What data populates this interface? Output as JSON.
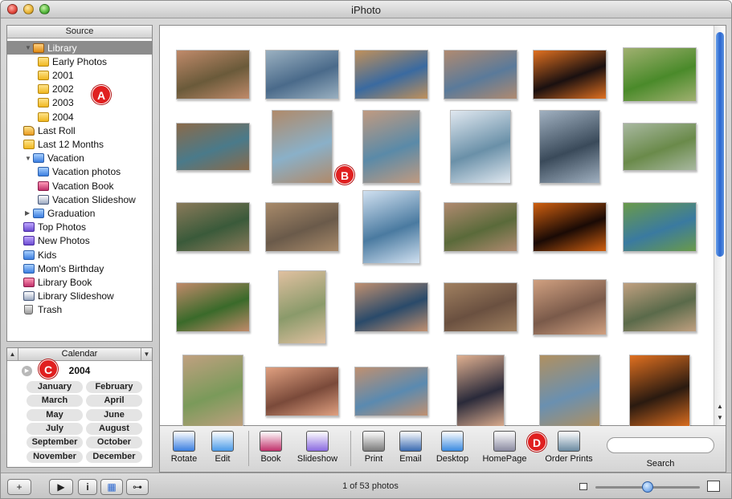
{
  "window": {
    "title": "iPhoto"
  },
  "source": {
    "header": "Source",
    "items": [
      {
        "label": "Library",
        "icon": "library-icon",
        "type": "libfolder",
        "indent": 0,
        "expand": "open",
        "selected": true
      },
      {
        "label": "Early Photos",
        "icon": "folder-icon",
        "type": "folder",
        "indent": 1
      },
      {
        "label": "2001",
        "icon": "folder-icon",
        "type": "folder",
        "indent": 1
      },
      {
        "label": "2002",
        "icon": "folder-icon",
        "type": "folder",
        "indent": 1
      },
      {
        "label": "2003",
        "icon": "folder-icon",
        "type": "folder",
        "indent": 1
      },
      {
        "label": "2004",
        "icon": "folder-icon",
        "type": "folder",
        "indent": 1
      },
      {
        "label": "Last Roll",
        "icon": "film-roll-icon",
        "type": "roll",
        "indent": 0
      },
      {
        "label": "Last 12 Months",
        "icon": "folder-icon",
        "type": "folder",
        "indent": 0
      },
      {
        "label": "Vacation",
        "icon": "folder-icon",
        "type": "album",
        "indent": 0,
        "expand": "open"
      },
      {
        "label": "Vacation photos",
        "icon": "album-icon",
        "type": "album",
        "indent": 1
      },
      {
        "label": "Vacation Book",
        "icon": "book-icon",
        "type": "book",
        "indent": 1
      },
      {
        "label": "Vacation Slideshow",
        "icon": "slideshow-icon",
        "type": "slide",
        "indent": 1
      },
      {
        "label": "Graduation",
        "icon": "folder-icon",
        "type": "album",
        "indent": 0,
        "expand": "closed"
      },
      {
        "label": "Top Photos",
        "icon": "smart-album-icon",
        "type": "smart",
        "indent": 0
      },
      {
        "label": "New Photos",
        "icon": "smart-album-icon",
        "type": "smart",
        "indent": 0
      },
      {
        "label": "Kids",
        "icon": "album-icon",
        "type": "album",
        "indent": 0
      },
      {
        "label": "Mom's Birthday",
        "icon": "album-icon",
        "type": "album",
        "indent": 0
      },
      {
        "label": "Library Book",
        "icon": "book-icon",
        "type": "book",
        "indent": 0
      },
      {
        "label": "Library Slideshow",
        "icon": "slideshow-icon",
        "type": "slide",
        "indent": 0
      },
      {
        "label": "Trash",
        "icon": "trash-icon",
        "type": "trash",
        "indent": 0
      }
    ]
  },
  "callouts": {
    "a": "A",
    "b": "B",
    "c": "C",
    "d": "D"
  },
  "calendar": {
    "header": "Calendar",
    "year": "2004",
    "months": [
      "January",
      "February",
      "March",
      "April",
      "May",
      "June",
      "July",
      "August",
      "September",
      "October",
      "November",
      "December"
    ]
  },
  "photos": [
    {
      "c1": "#6a5a3a",
      "c2": "#c08a6a"
    },
    {
      "c1": "#4a6a8a",
      "c2": "#9ab0c0"
    },
    {
      "c1": "#3a6aa0",
      "c2": "#c0905a"
    },
    {
      "c1": "#5a7a9a",
      "c2": "#b08a70"
    },
    {
      "c1": "#1a1010",
      "c2": "#e07020"
    },
    {
      "c1": "#4a8a2a",
      "c2": "#a0b070"
    },
    {
      "c1": "#4a7a8a",
      "c2": "#8a6a4a"
    },
    {
      "c1": "#8ab0c8",
      "c2": "#b08a6a"
    },
    {
      "c1": "#5a8aa8",
      "c2": "#c09a80"
    },
    {
      "c1": "#6a90a8",
      "c2": "#e0e8f0"
    },
    {
      "c1": "#3a4a5a",
      "c2": "#a0b0c0"
    },
    {
      "c1": "#6a8a4a",
      "c2": "#a8b8a0"
    },
    {
      "c1": "#3a5a3a",
      "c2": "#8a7a5a"
    },
    {
      "c1": "#6a5a4a",
      "c2": "#a88a6a"
    },
    {
      "c1": "#4a7aa0",
      "c2": "#d0e0f0"
    },
    {
      "c1": "#5a6a3a",
      "c2": "#b08a70"
    },
    {
      "c1": "#1a0a05",
      "c2": "#d06010"
    },
    {
      "c1": "#3a7aa0",
      "c2": "#6a9a4a"
    },
    {
      "c1": "#3a6a2a",
      "c2": "#c08a6a"
    },
    {
      "c1": "#8a9a6a",
      "c2": "#e0c0a0"
    },
    {
      "c1": "#2a4a6a",
      "c2": "#c09070"
    },
    {
      "c1": "#6a5040",
      "c2": "#a08060"
    },
    {
      "c1": "#7a5a4a",
      "c2": "#d0a080"
    },
    {
      "c1": "#5a6a4a",
      "c2": "#c0a080"
    },
    {
      "c1": "#7a9a5a",
      "c2": "#c0a080"
    },
    {
      "c1": "#7a4a3a",
      "c2": "#e0a080"
    },
    {
      "c1": "#5a8ab0",
      "c2": "#c09070"
    },
    {
      "c1": "#2a2a3a",
      "c2": "#e0b090"
    },
    {
      "c1": "#6a90b0",
      "c2": "#b09060"
    },
    {
      "c1": "#2a1a10",
      "c2": "#e07020"
    }
  ],
  "toolbar": {
    "tools": [
      {
        "label": "Rotate",
        "icon": "rotate-icon",
        "color": "#3a7ee0"
      },
      {
        "label": "Edit",
        "icon": "edit-icon",
        "color": "#4a9ae8"
      },
      {
        "label": "Book",
        "icon": "book-icon",
        "color": "#c0306a"
      },
      {
        "label": "Slideshow",
        "icon": "slideshow-icon",
        "color": "#8a6ae0"
      },
      {
        "label": "Print",
        "icon": "print-icon",
        "color": "#7a7a7a"
      },
      {
        "label": "Email",
        "icon": "email-icon",
        "color": "#3a6ab0"
      },
      {
        "label": "Desktop",
        "icon": "desktop-icon",
        "color": "#3a8ae0"
      },
      {
        "label": "HomePage",
        "icon": "homepage-icon",
        "color": "#8a8aa0"
      },
      {
        "label": "Order Prints",
        "icon": "order-prints-icon",
        "color": "#6a8aa0"
      }
    ],
    "search_label": "Search"
  },
  "bottombar": {
    "add_label": "+",
    "play_label": "▶",
    "info_label": "i",
    "calendar_label": "▦",
    "keyword_label": "⊶",
    "status": "1 of 53 photos",
    "zoom_level": 0.5
  }
}
